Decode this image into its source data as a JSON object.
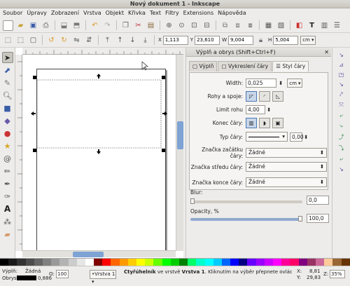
{
  "window": {
    "title": "Nový dokument 1 - Inkscape"
  },
  "menu": [
    "Soubor",
    "Úpravy",
    "Zobrazení",
    "Vrstva",
    "Objekt",
    "Křivka",
    "Text",
    "Filtry",
    "Extensions",
    "Nápověda"
  ],
  "coords": {
    "x_label": "X",
    "x_value": "1,113",
    "y_label": "Y",
    "y_value": "23,610",
    "w_label": "W",
    "w_value": "9,004",
    "h_label": "H",
    "h_value": "5,004",
    "unit": "cm"
  },
  "panel": {
    "title": "Výplň a obrys (Shift+Ctrl+F)",
    "tabs": [
      "Výplň",
      "Vykreslení čáry",
      "Styl čáry"
    ],
    "width_label": "Width:",
    "width_value": "0,025",
    "width_unit": "cm",
    "joins_label": "Rohy a spoje:",
    "miter_label": "Limit rohu",
    "miter_value": "4,00",
    "cap_label": "Konec čáry:",
    "dash_label": "Typ čáry:",
    "dash_value": "0,00",
    "start_marker_label": "Značka začátku čáry:",
    "start_marker_value": "Žádné",
    "mid_marker_label": "Značka středu čáry:",
    "mid_marker_value": "Žádné",
    "end_marker_label": "Značka konce čáry:",
    "end_marker_value": "Žádné",
    "blur_label": "Blur:",
    "blur_value": "0,0",
    "opacity_label": "Opacity, %",
    "opacity_value": "100,0"
  },
  "status": {
    "fill_label": "Výplň:",
    "fill_value": "Žádná",
    "stroke_label": "Obrys:",
    "stroke_value": "0,886",
    "opacity_label": "O:",
    "opacity_value": "100",
    "layer": "•Vrstva 1",
    "message_bold": "Čtyřúhelník",
    "message_mid": " ve vrstvě ",
    "message_layer": "Vrstva 1",
    "message_rest": ". Kliknutím na výběr přepnete ovládací ...",
    "x_label": "X:",
    "x_value": "8,81",
    "y_label": "Y:",
    "y_value": "29,83",
    "z_label": "Z:",
    "z_value": "35%"
  },
  "palette_colors": [
    "#000000",
    "#1a1a1a",
    "#333333",
    "#4d4d4d",
    "#666666",
    "#808080",
    "#999999",
    "#b3b3b3",
    "#cccccc",
    "#e6e6e6",
    "#ffffff",
    "#800000",
    "#ff0000",
    "#ff6600",
    "#ff9900",
    "#ffcc00",
    "#ffff00",
    "#ccff00",
    "#66ff00",
    "#00ff00",
    "#00cc00",
    "#008000",
    "#00ff66",
    "#00ffcc",
    "#00ffff",
    "#00ccff",
    "#0066ff",
    "#0000ff",
    "#000080",
    "#6600ff",
    "#9900ff",
    "#cc00ff",
    "#ff00ff",
    "#ff0099",
    "#ff0066",
    "#800080",
    "#993366",
    "#cc6699",
    "#ffcc99",
    "#996633",
    "#663300"
  ]
}
